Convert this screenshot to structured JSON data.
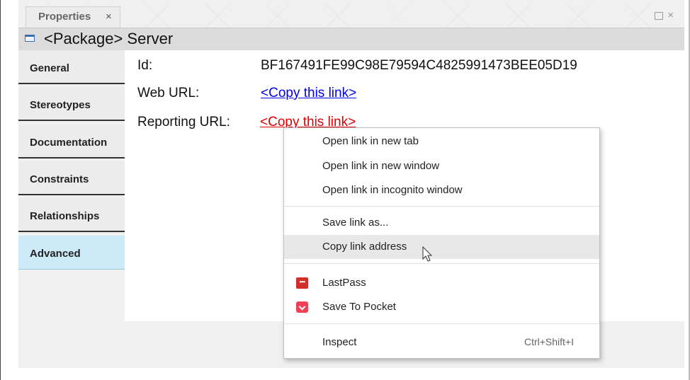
{
  "view": {
    "tab_label": "Properties",
    "tab_close": "×",
    "view_controls_close": "×"
  },
  "title": {
    "text": "<Package> Server"
  },
  "sidebar": {
    "tabs": [
      {
        "label": "General"
      },
      {
        "label": "Stereotypes"
      },
      {
        "label": "Documentation"
      },
      {
        "label": "Constraints"
      },
      {
        "label": "Relationships"
      },
      {
        "label": "Advanced"
      }
    ],
    "active": "Advanced"
  },
  "properties": {
    "id_label": "Id:",
    "id_value": "BF167491FE99C98E79594C4825991473BEE05D19",
    "web_url_label": "Web URL:",
    "web_url_value": "<Copy this link>",
    "reporting_url_label": "Reporting URL:",
    "reporting_url_value": "<Copy this link>"
  },
  "context_menu": {
    "items": [
      {
        "label": "Open link in new tab"
      },
      {
        "label": "Open link in new window"
      },
      {
        "label": "Open link in incognito window"
      },
      {
        "label": "Save link as..."
      },
      {
        "label": "Copy link address"
      },
      {
        "label": "LastPass",
        "icon": "lastpass-icon"
      },
      {
        "label": "Save To Pocket",
        "icon": "pocket-icon"
      },
      {
        "label": "Inspect",
        "shortcut": "Ctrl+Shift+I"
      }
    ],
    "highlighted": "Copy link address",
    "lastpass_icon_text": "•••"
  },
  "colors": {
    "active_tab": "#cdeaf8",
    "link_blue": "#0000ee",
    "link_red": "#e00000",
    "lastpass": "#d32d27",
    "pocket": "#ef4056"
  }
}
